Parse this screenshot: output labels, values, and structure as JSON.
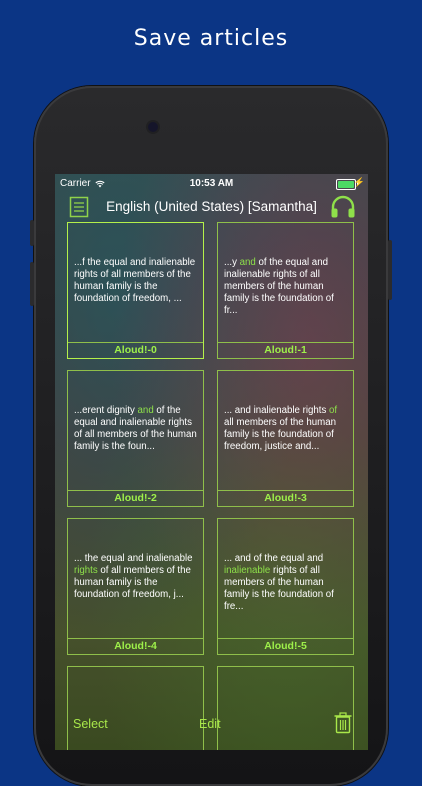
{
  "headline": "Save articles",
  "status": {
    "carrier": "Carrier",
    "time": "10:53 AM",
    "battery_level": 1.0
  },
  "nav": {
    "title": "English (United States) [Samantha]",
    "left_icon": "list-icon",
    "right_icon": "headphones-icon"
  },
  "cards": [
    {
      "before": "...f the equal and inalienable rights of all members of the human family is the foundation of freedom, ...",
      "highlight": "",
      "after": "",
      "label": "Aloud!-0"
    },
    {
      "before": "...y ",
      "highlight": "and",
      "after": " of the equal and inalienable rights of all members of the human family is the foundation of fr...",
      "label": "Aloud!-1"
    },
    {
      "before": "...erent dignity ",
      "highlight": "and",
      "after": " of the equal and inalienable rights of all members of the human family is the foun...",
      "label": "Aloud!-2"
    },
    {
      "before": "... and inalienable rights ",
      "highlight": "of",
      "after": " all members of the human family is the foundation of freedom, justice and...",
      "label": "Aloud!-3"
    },
    {
      "before": "... the equal and inalienable ",
      "highlight": "rights",
      "after": " of all members of the human family is the foundation of freedom, j...",
      "label": "Aloud!-4"
    },
    {
      "before": "... and of the equal and ",
      "highlight": "inalienable",
      "after": " rights of all members of the human family is the foundation of fre...",
      "label": "Aloud!-5"
    }
  ],
  "toolbar": {
    "select_label": "Select",
    "edit_label": "Edit",
    "trash_icon": "trash-icon"
  },
  "colors": {
    "background": "#0b3585",
    "accent": "#9ef04a",
    "highlight": "#8ee04a"
  }
}
